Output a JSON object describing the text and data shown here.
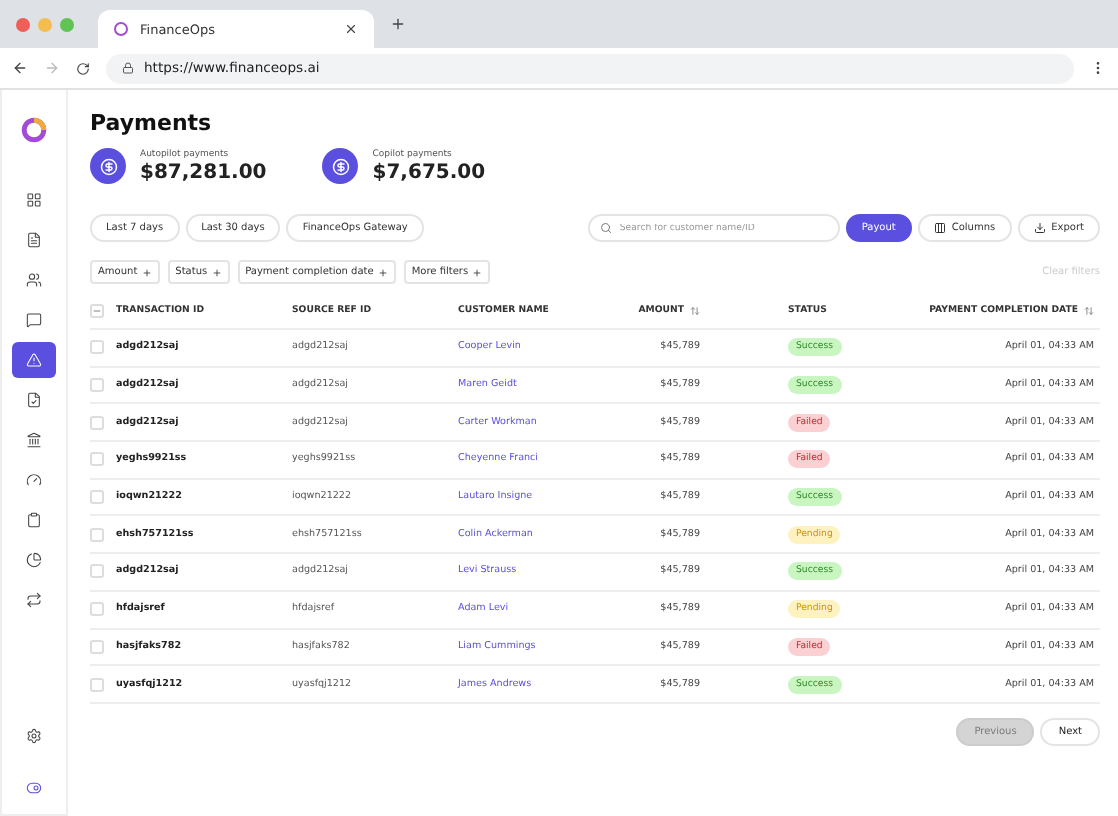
{
  "browser": {
    "tab_title": "FinanceOps",
    "url": "https://www.financeops.ai"
  },
  "sidebar": {
    "items": [
      {
        "kind": "grid",
        "selected": false
      },
      {
        "kind": "report",
        "selected": false
      },
      {
        "kind": "users",
        "selected": false
      },
      {
        "kind": "chat",
        "selected": false
      },
      {
        "kind": "alert",
        "selected": true
      },
      {
        "kind": "invoice",
        "selected": false
      },
      {
        "kind": "bank",
        "selected": false
      },
      {
        "kind": "gauge",
        "selected": false
      },
      {
        "kind": "clipboard",
        "selected": false
      },
      {
        "kind": "pie",
        "selected": false
      },
      {
        "kind": "flow",
        "selected": false
      }
    ],
    "footer": [
      {
        "kind": "settings"
      },
      {
        "kind": "toggle"
      }
    ]
  },
  "page": {
    "title": "Payments",
    "stats": [
      {
        "label": "Autopilot payments",
        "value": "$87,281.00"
      },
      {
        "label": "Copilot payments",
        "value": "$7,675.00"
      }
    ]
  },
  "quick_filters": [
    {
      "label": "Last 7 days"
    },
    {
      "label": "Last 30 days"
    },
    {
      "label": "FinanceOps Gateway"
    }
  ],
  "search": {
    "placeholder": "Search for customer name/ID"
  },
  "actions": [
    {
      "label": "Payout",
      "kind": "primary"
    },
    {
      "label": "Columns",
      "kind": "columns"
    },
    {
      "label": "Export",
      "kind": "export"
    }
  ],
  "filters": [
    {
      "label": "Amount"
    },
    {
      "label": "Status"
    },
    {
      "label": "Payment completion date"
    },
    {
      "label": "More filters"
    }
  ],
  "clear_filters": {
    "label": "Clear filters",
    "disabled": true
  },
  "table": {
    "select_all": {
      "indeterminate": true
    },
    "columns": [
      {
        "label": "TRANSACTION ID",
        "sortable": false
      },
      {
        "label": "SOURCE REF ID",
        "sortable": false
      },
      {
        "label": "CUSTOMER NAME",
        "sortable": false
      },
      {
        "label": "AMOUNT",
        "sortable": true
      },
      {
        "label": "STATUS",
        "sortable": false
      },
      {
        "label": "PAYMENT COMPLETION DATE",
        "sortable": true
      }
    ],
    "rows": [
      {
        "checked": false,
        "transaction_id": "adgd212saj",
        "source_ref": "adgd212saj",
        "customer": "Cooper Levin",
        "amount": "$45,789",
        "status": {
          "label": "Success",
          "kind": "success"
        },
        "date": "April 01, 04:33 AM"
      },
      {
        "checked": false,
        "transaction_id": "adgd212saj",
        "source_ref": "adgd212saj",
        "customer": "Maren Geidt",
        "amount": "$45,789",
        "status": {
          "label": "Success",
          "kind": "success"
        },
        "date": "April 01, 04:33 AM"
      },
      {
        "checked": false,
        "transaction_id": "adgd212saj",
        "source_ref": "adgd212saj",
        "customer": "Carter Workman",
        "amount": "$45,789",
        "status": {
          "label": "Failed",
          "kind": "failed"
        },
        "date": "April 01, 04:33 AM"
      },
      {
        "checked": false,
        "transaction_id": "yeghs9921ss",
        "source_ref": "yeghs9921ss",
        "customer": "Cheyenne Franci",
        "amount": "$45,789",
        "status": {
          "label": "Failed",
          "kind": "failed"
        },
        "date": "April 01, 04:33 AM"
      },
      {
        "checked": false,
        "transaction_id": "ioqwn21222",
        "source_ref": "ioqwn21222",
        "customer": "Lautaro Insigne",
        "amount": "$45,789",
        "status": {
          "label": "Success",
          "kind": "success"
        },
        "date": "April 01, 04:33 AM"
      },
      {
        "checked": false,
        "transaction_id": "ehsh757121ss",
        "source_ref": "ehsh757121ss",
        "customer": "Colin Ackerman",
        "amount": "$45,789",
        "status": {
          "label": "Pending",
          "kind": "pending"
        },
        "date": "April 01, 04:33 AM"
      },
      {
        "checked": false,
        "transaction_id": "adgd212saj",
        "source_ref": "adgd212saj",
        "customer": "Levi Strauss",
        "amount": "$45,789",
        "status": {
          "label": "Success",
          "kind": "success"
        },
        "date": "April 01, 04:33 AM"
      },
      {
        "checked": false,
        "transaction_id": "hfdajsref",
        "source_ref": "hfdajsref",
        "customer": "Adam Levi",
        "amount": "$45,789",
        "status": {
          "label": "Pending",
          "kind": "pending"
        },
        "date": "April 01, 04:33 AM"
      },
      {
        "checked": false,
        "transaction_id": "hasjfaks782",
        "source_ref": "hasjfaks782",
        "customer": "Liam Cummings",
        "amount": "$45,789",
        "status": {
          "label": "Failed",
          "kind": "failed"
        },
        "date": "April 01, 04:33 AM"
      },
      {
        "checked": false,
        "transaction_id": "uyasfqj1212",
        "source_ref": "uyasfqj1212",
        "customer": "James Andrews",
        "amount": "$45,789",
        "status": {
          "label": "Success",
          "kind": "success"
        },
        "date": "April 01, 04:33 AM"
      }
    ]
  },
  "pagination": [
    {
      "label": "Previous",
      "disabled": true
    },
    {
      "label": "Next",
      "disabled": false
    }
  ]
}
